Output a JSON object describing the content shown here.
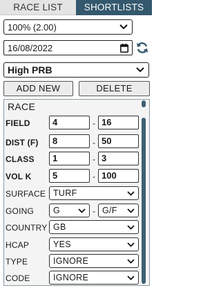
{
  "tabs": [
    {
      "label": "RACE LIST",
      "active": false
    },
    {
      "label": "SHORTLISTS",
      "active": true
    }
  ],
  "zoom": {
    "value": "100% (2.00)"
  },
  "date": {
    "value": "16/08/2022"
  },
  "shortlist": {
    "value": "High PRB"
  },
  "buttons": {
    "add_new": "ADD NEW",
    "delete": "DELETE"
  },
  "race": {
    "title": "RACE",
    "field": {
      "label": "FIELD",
      "min": "4",
      "max": "16"
    },
    "dist": {
      "label": "DIST (F)",
      "min": "8",
      "max": "50"
    },
    "class": {
      "label": "CLASS",
      "min": "1",
      "max": "3"
    },
    "volk": {
      "label": "VOL K",
      "min": "5",
      "max": "100"
    },
    "surface": {
      "label": "SURFACE",
      "value": "TURF"
    },
    "going": {
      "label": "GOING",
      "from": "G",
      "to": "G/F"
    },
    "country": {
      "label": "COUNTRY",
      "value": "GB"
    },
    "hcap": {
      "label": "HCAP",
      "value": "YES"
    },
    "type": {
      "label": "TYPE",
      "value": "IGNORE"
    },
    "code": {
      "label": "CODE",
      "value": "IGNORE"
    },
    "dash": "-"
  },
  "colors": {
    "active_tab": "#34586e",
    "scrollbar": "#3e5f73"
  }
}
